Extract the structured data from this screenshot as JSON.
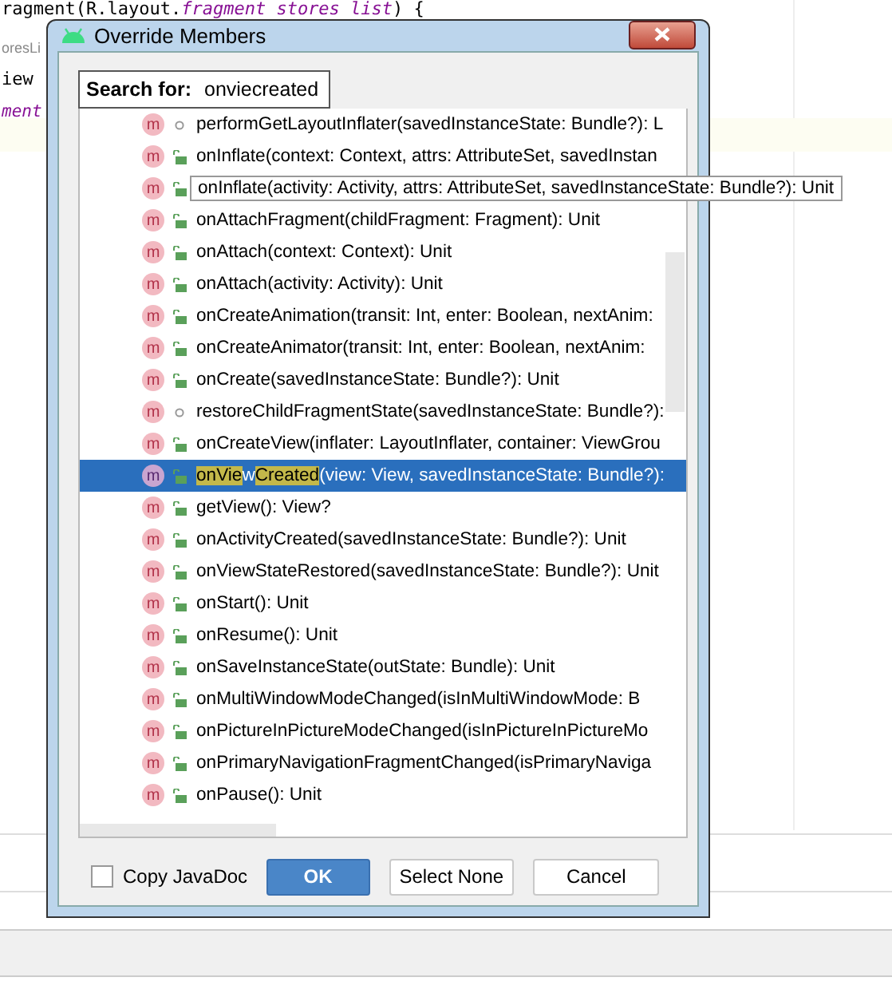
{
  "editor": {
    "lines": [
      {
        "kind": "code",
        "text": "ragment(R.layout.",
        "italic_text": "fragment stores list",
        "tail": ") {"
      },
      {
        "kind": "hint",
        "text": "oresLi"
      },
      {
        "kind": "code",
        "text": "iew"
      },
      {
        "kind": "italic",
        "text": "ment"
      }
    ]
  },
  "dialog": {
    "title": "Override Members",
    "search": {
      "label": "Search for:",
      "value": "onviecreated"
    },
    "members": [
      {
        "kind": "protected",
        "badge": "m",
        "selected": false,
        "text": "performGetLayoutInflater(savedInstanceState: Bundle?): L"
      },
      {
        "kind": "public",
        "badge": "m",
        "selected": false,
        "text": "onInflate(context: Context, attrs: AttributeSet, savedInstan"
      },
      {
        "kind": "public",
        "badge": "m",
        "selected": false,
        "tooltip": true,
        "text": "onInflate(activity: Activity, attrs: AttributeSet, savedInstanceState: Bundle?): Unit"
      },
      {
        "kind": "public",
        "badge": "m",
        "selected": false,
        "text": "onAttachFragment(childFragment: Fragment): Unit"
      },
      {
        "kind": "public",
        "badge": "m",
        "selected": false,
        "text": "onAttach(context: Context): Unit"
      },
      {
        "kind": "public",
        "badge": "m",
        "selected": false,
        "text": "onAttach(activity: Activity): Unit"
      },
      {
        "kind": "public",
        "badge": "m",
        "selected": false,
        "text": "onCreateAnimation(transit: Int, enter: Boolean, nextAnim:"
      },
      {
        "kind": "public",
        "badge": "m",
        "selected": false,
        "text": "onCreateAnimator(transit: Int, enter: Boolean, nextAnim:"
      },
      {
        "kind": "public",
        "badge": "m",
        "selected": false,
        "text": "onCreate(savedInstanceState: Bundle?): Unit"
      },
      {
        "kind": "protected",
        "badge": "m",
        "selected": false,
        "text": "restoreChildFragmentState(savedInstanceState: Bundle?):"
      },
      {
        "kind": "public",
        "badge": "m",
        "selected": false,
        "text": "onCreateView(inflater: LayoutInflater, container: ViewGrou"
      },
      {
        "kind": "public",
        "badge": "m",
        "selected": true,
        "parts": [
          {
            "text": "onVie",
            "match": true
          },
          {
            "text": "w",
            "match": false
          },
          {
            "text": "Created",
            "match": true
          },
          {
            "text": "(view: View, savedInstanceState: Bundle?):",
            "match": false
          }
        ]
      },
      {
        "kind": "public",
        "badge": "m",
        "selected": false,
        "text": "getView(): View?"
      },
      {
        "kind": "public",
        "badge": "m",
        "selected": false,
        "text": "onActivityCreated(savedInstanceState: Bundle?): Unit"
      },
      {
        "kind": "public",
        "badge": "m",
        "selected": false,
        "text": "onViewStateRestored(savedInstanceState: Bundle?): Unit"
      },
      {
        "kind": "public",
        "badge": "m",
        "selected": false,
        "text": "onStart(): Unit"
      },
      {
        "kind": "public",
        "badge": "m",
        "selected": false,
        "text": "onResume(): Unit"
      },
      {
        "kind": "public",
        "badge": "m",
        "selected": false,
        "text": "onSaveInstanceState(outState: Bundle): Unit"
      },
      {
        "kind": "public",
        "badge": "m",
        "selected": false,
        "text": "onMultiWindowModeChanged(isInMultiWindowMode: B"
      },
      {
        "kind": "public",
        "badge": "m",
        "selected": false,
        "text": "onPictureInPictureModeChanged(isInPictureInPictureMo"
      },
      {
        "kind": "public",
        "badge": "m",
        "selected": false,
        "text": "onPrimaryNavigationFragmentChanged(isPrimaryNaviga"
      },
      {
        "kind": "public",
        "badge": "m",
        "selected": false,
        "text": "onPause(): Unit"
      }
    ],
    "copy_javadoc": {
      "label": "Copy JavaDoc",
      "checked": false
    },
    "buttons": [
      {
        "label": "OK",
        "primary": true
      },
      {
        "label": "Select None",
        "primary": false
      },
      {
        "label": "Cancel",
        "primary": false
      }
    ]
  }
}
